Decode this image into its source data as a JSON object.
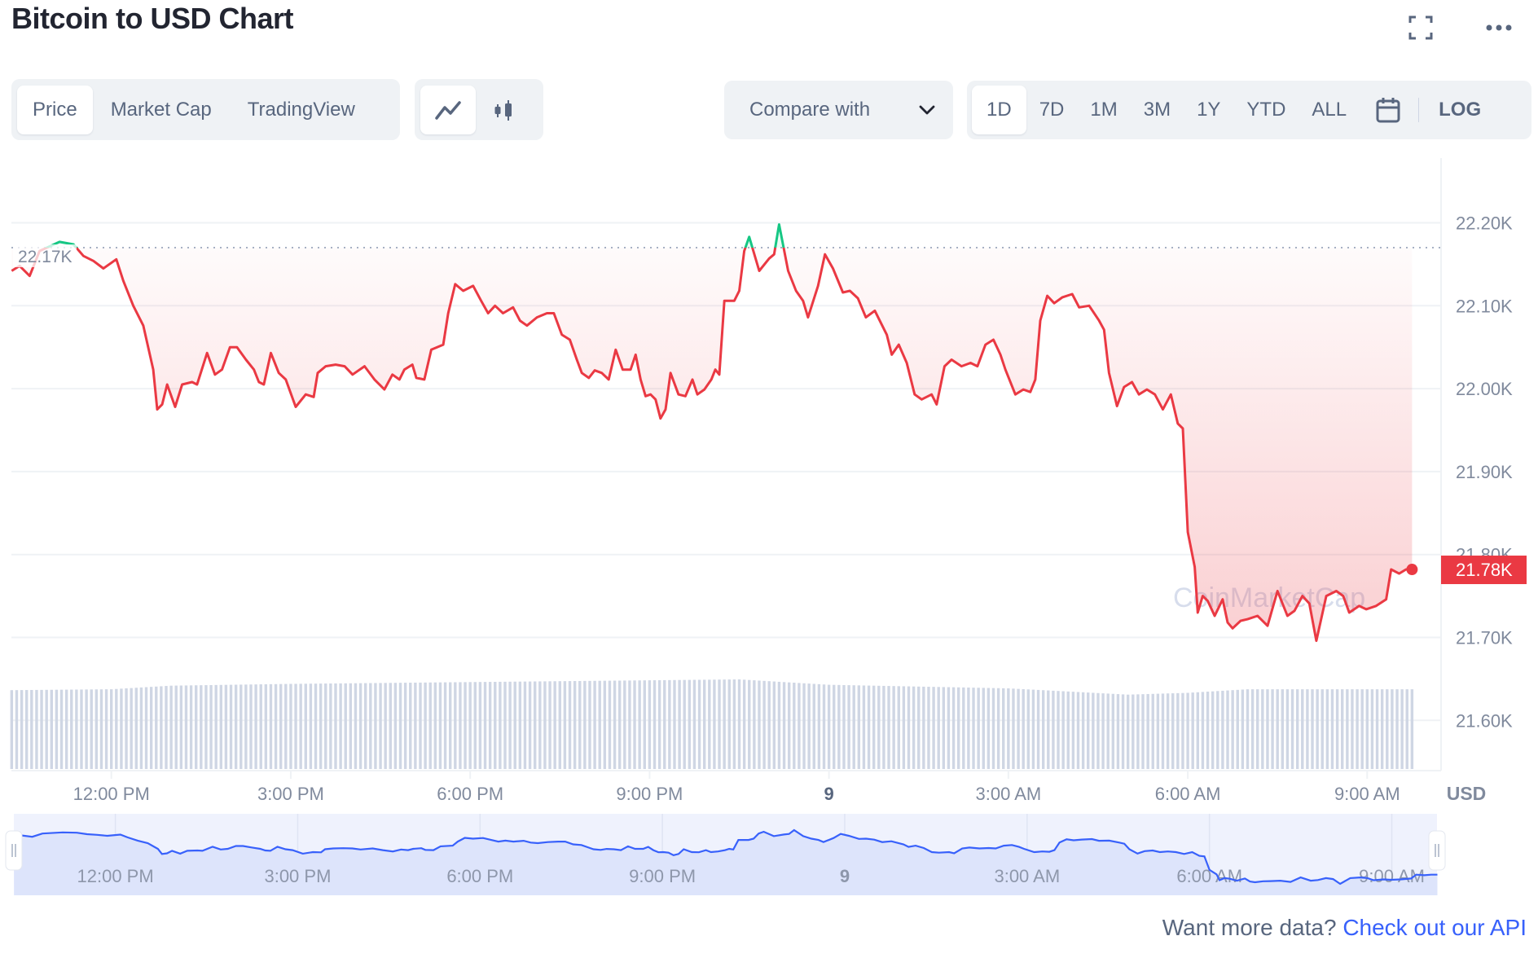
{
  "header": {
    "title": "Bitcoin to USD Chart",
    "fullscreen_icon": "fullscreen-icon",
    "more_icon": "more-horizontal-icon"
  },
  "toolbar": {
    "data_tabs": [
      {
        "label": "Price",
        "active": true
      },
      {
        "label": "Market Cap",
        "active": false
      },
      {
        "label": "TradingView",
        "active": false
      }
    ],
    "chart_types": [
      {
        "icon": "line-chart-icon",
        "active": true
      },
      {
        "icon": "candlestick-icon",
        "active": false
      }
    ],
    "compare": {
      "label": "Compare with",
      "icon": "chevron-down-icon"
    },
    "ranges": [
      {
        "label": "1D",
        "active": true
      },
      {
        "label": "7D",
        "active": false
      },
      {
        "label": "1M",
        "active": false
      },
      {
        "label": "3M",
        "active": false
      },
      {
        "label": "1Y",
        "active": false
      },
      {
        "label": "YTD",
        "active": false
      },
      {
        "label": "ALL",
        "active": false
      }
    ],
    "calendar_icon": "calendar-icon",
    "log_label": "LOG"
  },
  "colors": {
    "down": "#ea3943",
    "up": "#16c784",
    "volume": "#cfd6e4",
    "navigator_line": "#3861fb",
    "navigator_fill": "#dde4fb",
    "navigator_bg": "#eff2fd",
    "link": "#3861fb"
  },
  "chart_data": {
    "type": "line",
    "currency_label": "USD",
    "watermark": "CoinMarketCap",
    "ylim": [
      21540,
      22280
    ],
    "grid": true,
    "y_ticks": [
      {
        "value": 22200,
        "label": "22.20K"
      },
      {
        "value": 22100,
        "label": "22.10K"
      },
      {
        "value": 22000,
        "label": "22.00K"
      },
      {
        "value": 21900,
        "label": "21.90K"
      },
      {
        "value": 21800,
        "label": "21.80K"
      },
      {
        "value": 21700,
        "label": "21.70K"
      },
      {
        "value": 21600,
        "label": "21.60K"
      }
    ],
    "x_ticks": [
      {
        "t": "8 12:00",
        "label": "12:00 PM",
        "bold": false
      },
      {
        "t": "8 15:00",
        "label": "3:00 PM",
        "bold": false
      },
      {
        "t": "8 18:00",
        "label": "6:00 PM",
        "bold": false
      },
      {
        "t": "8 21:00",
        "label": "9:00 PM",
        "bold": false
      },
      {
        "t": "9 00:00",
        "label": "9",
        "bold": true
      },
      {
        "t": "9 03:00",
        "label": "3:00 AM",
        "bold": false
      },
      {
        "t": "9 06:00",
        "label": "6:00 AM",
        "bold": false
      },
      {
        "t": "9 09:00",
        "label": "9:00 AM",
        "bold": false
      }
    ],
    "reference": {
      "value": 22170,
      "label": "22.17K"
    },
    "current": {
      "value": 21782,
      "label": "21.78K"
    },
    "series": [
      {
        "points": [
          [
            "8 10:20",
            22142
          ],
          [
            "8 10:28",
            22148
          ],
          [
            "8 10:38",
            22136
          ],
          [
            "8 10:48",
            22166
          ],
          [
            "8 11:08",
            22177
          ],
          [
            "8 11:22",
            22174
          ],
          [
            "8 11:32",
            22160
          ],
          [
            "8 11:42",
            22154
          ],
          [
            "8 11:52",
            22145
          ],
          [
            "8 12:05",
            22156
          ],
          [
            "8 12:12",
            22130
          ],
          [
            "8 12:22",
            22100
          ],
          [
            "8 12:32",
            22076
          ],
          [
            "8 12:42",
            22023
          ],
          [
            "8 12:46",
            21975
          ],
          [
            "8 12:51",
            21981
          ],
          [
            "8 12:56",
            22005
          ],
          [
            "8 13:04",
            21978
          ],
          [
            "8 13:11",
            22005
          ],
          [
            "8 13:21",
            22008
          ],
          [
            "8 13:26",
            22005
          ],
          [
            "8 13:36",
            22043
          ],
          [
            "8 13:44",
            22017
          ],
          [
            "8 13:51",
            22023
          ],
          [
            "8 13:59",
            22050
          ],
          [
            "8 14:06",
            22050
          ],
          [
            "8 14:15",
            22035
          ],
          [
            "8 14:23",
            22023
          ],
          [
            "8 14:28",
            22008
          ],
          [
            "8 14:33",
            22005
          ],
          [
            "8 14:40",
            22043
          ],
          [
            "8 14:48",
            22019
          ],
          [
            "8 14:55",
            22011
          ],
          [
            "8 15:05",
            21978
          ],
          [
            "8 15:15",
            21993
          ],
          [
            "8 15:23",
            21990
          ],
          [
            "8 15:27",
            22019
          ],
          [
            "8 15:35",
            22027
          ],
          [
            "8 15:45",
            22029
          ],
          [
            "8 15:54",
            22027
          ],
          [
            "8 16:02",
            22017
          ],
          [
            "8 16:14",
            22027
          ],
          [
            "8 16:24",
            22011
          ],
          [
            "8 16:34",
            21999
          ],
          [
            "8 16:42",
            22017
          ],
          [
            "8 16:49",
            22011
          ],
          [
            "8 16:54",
            22023
          ],
          [
            "8 17:02",
            22029
          ],
          [
            "8 17:06",
            22013
          ],
          [
            "8 17:14",
            22011
          ],
          [
            "8 17:21",
            22047
          ],
          [
            "8 17:33",
            22053
          ],
          [
            "8 17:38",
            22091
          ],
          [
            "8 17:45",
            22126
          ],
          [
            "8 17:53",
            22118
          ],
          [
            "8 18:03",
            22124
          ],
          [
            "8 18:11",
            22106
          ],
          [
            "8 18:18",
            22091
          ],
          [
            "8 18:25",
            22100
          ],
          [
            "8 18:33",
            22091
          ],
          [
            "8 18:43",
            22098
          ],
          [
            "8 18:50",
            22082
          ],
          [
            "8 18:57",
            22076
          ],
          [
            "8 19:07",
            22086
          ],
          [
            "8 19:17",
            22091
          ],
          [
            "8 19:24",
            22091
          ],
          [
            "8 19:32",
            22065
          ],
          [
            "8 19:40",
            22059
          ],
          [
            "8 19:47",
            22035
          ],
          [
            "8 19:52",
            22019
          ],
          [
            "8 19:59",
            22013
          ],
          [
            "8 20:05",
            22022
          ],
          [
            "8 20:12",
            22019
          ],
          [
            "8 20:19",
            22011
          ],
          [
            "8 20:26",
            22047
          ],
          [
            "8 20:33",
            22023
          ],
          [
            "8 20:41",
            22023
          ],
          [
            "8 20:46",
            22041
          ],
          [
            "8 20:51",
            22011
          ],
          [
            "8 20:56",
            21991
          ],
          [
            "8 21:01",
            21993
          ],
          [
            "8 21:06",
            21987
          ],
          [
            "8 21:11",
            21964
          ],
          [
            "8 21:16",
            21975
          ],
          [
            "8 21:21",
            22019
          ],
          [
            "8 21:29",
            21993
          ],
          [
            "8 21:36",
            21991
          ],
          [
            "8 21:43",
            22011
          ],
          [
            "8 21:48",
            21993
          ],
          [
            "8 21:55",
            21999
          ],
          [
            "8 22:02",
            22011
          ],
          [
            "8 22:06",
            22023
          ],
          [
            "8 22:10",
            22017
          ],
          [
            "8 22:15",
            22106
          ],
          [
            "8 22:25",
            22106
          ],
          [
            "8 22:30",
            22118
          ],
          [
            "8 22:35",
            22166
          ],
          [
            "8 22:40",
            22183
          ],
          [
            "8 22:50",
            22142
          ],
          [
            "8 23:00",
            22157
          ],
          [
            "8 23:05",
            22162
          ],
          [
            "8 23:10",
            22198
          ],
          [
            "8 23:19",
            22142
          ],
          [
            "8 23:27",
            22118
          ],
          [
            "8 23:34",
            22106
          ],
          [
            "8 23:39",
            22086
          ],
          [
            "8 23:49",
            22124
          ],
          [
            "8 23:56",
            22162
          ],
          [
            "9 00:04",
            22145
          ],
          [
            "9 00:14",
            22116
          ],
          [
            "9 00:21",
            22118
          ],
          [
            "9 00:29",
            22109
          ],
          [
            "9 00:37",
            22086
          ],
          [
            "9 00:46",
            22094
          ],
          [
            "9 00:58",
            22065
          ],
          [
            "9 01:03",
            22041
          ],
          [
            "9 01:10",
            22053
          ],
          [
            "9 01:18",
            22031
          ],
          [
            "9 01:26",
            21993
          ],
          [
            "9 01:33",
            21987
          ],
          [
            "9 01:43",
            21993
          ],
          [
            "9 01:48",
            21981
          ],
          [
            "9 01:56",
            22027
          ],
          [
            "9 02:03",
            22035
          ],
          [
            "9 02:13",
            22027
          ],
          [
            "9 02:22",
            22031
          ],
          [
            "9 02:29",
            22027
          ],
          [
            "9 02:37",
            22053
          ],
          [
            "9 02:45",
            22059
          ],
          [
            "9 02:52",
            22041
          ],
          [
            "9 02:57",
            22023
          ],
          [
            "9 03:07",
            21993
          ],
          [
            "9 03:15",
            21999
          ],
          [
            "9 03:22",
            21996
          ],
          [
            "9 03:27",
            22011
          ],
          [
            "9 03:32",
            22082
          ],
          [
            "9 03:39",
            22112
          ],
          [
            "9 03:46",
            22103
          ],
          [
            "9 03:54",
            22110
          ],
          [
            "9 04:04",
            22114
          ],
          [
            "9 04:11",
            22098
          ],
          [
            "9 04:21",
            22100
          ],
          [
            "9 04:31",
            22082
          ],
          [
            "9 04:36",
            22071
          ],
          [
            "9 04:41",
            22019
          ],
          [
            "9 04:49",
            21979
          ],
          [
            "9 04:56",
            22002
          ],
          [
            "9 05:04",
            22008
          ],
          [
            "9 05:11",
            21993
          ],
          [
            "9 05:19",
            21999
          ],
          [
            "9 05:27",
            21993
          ],
          [
            "9 05:35",
            21975
          ],
          [
            "9 05:43",
            21993
          ],
          [
            "9 05:50",
            21958
          ],
          [
            "9 05:55",
            21952
          ],
          [
            "9 06:00",
            21827
          ],
          [
            "9 06:07",
            21785
          ],
          [
            "9 06:10",
            21730
          ],
          [
            "9 06:15",
            21750
          ],
          [
            "9 06:20",
            21744
          ],
          [
            "9 06:27",
            21726
          ],
          [
            "9 06:35",
            21746
          ],
          [
            "9 06:40",
            21718
          ],
          [
            "9 06:45",
            21711
          ],
          [
            "9 06:53",
            21720
          ],
          [
            "9 07:00",
            21722
          ],
          [
            "9 07:10",
            21726
          ],
          [
            "9 07:20",
            21714
          ],
          [
            "9 07:30",
            21756
          ],
          [
            "9 07:40",
            21726
          ],
          [
            "9 07:47",
            21732
          ],
          [
            "9 07:55",
            21750
          ],
          [
            "9 08:02",
            21741
          ],
          [
            "9 08:09",
            21696
          ],
          [
            "9 08:19",
            21750
          ],
          [
            "9 08:29",
            21756
          ],
          [
            "9 08:36",
            21750
          ],
          [
            "9 08:42",
            21730
          ],
          [
            "9 08:52",
            21738
          ],
          [
            "9 08:59",
            21734
          ],
          [
            "9 09:09",
            21738
          ],
          [
            "9 09:19",
            21746
          ],
          [
            "9 09:24",
            21782
          ],
          [
            "9 09:32",
            21777
          ],
          [
            "9 09:39",
            21782
          ],
          [
            "9 09:45",
            21782
          ]
        ]
      }
    ],
    "volume_relative": [
      [
        "8 10:20",
        0.88
      ],
      [
        "8 12:00",
        0.89
      ],
      [
        "8 13:00",
        0.93
      ],
      [
        "8 15:00",
        0.95
      ],
      [
        "8 18:00",
        0.97
      ],
      [
        "8 21:00",
        0.99
      ],
      [
        "8 22:30",
        1.0
      ],
      [
        "9 00:00",
        0.94
      ],
      [
        "9 03:00",
        0.9
      ],
      [
        "9 05:00",
        0.83
      ],
      [
        "9 06:00",
        0.85
      ],
      [
        "9 07:00",
        0.89
      ],
      [
        "9 09:45",
        0.89
      ]
    ]
  },
  "footer": {
    "prompt": "Want more data?",
    "link": "Check out our API"
  }
}
